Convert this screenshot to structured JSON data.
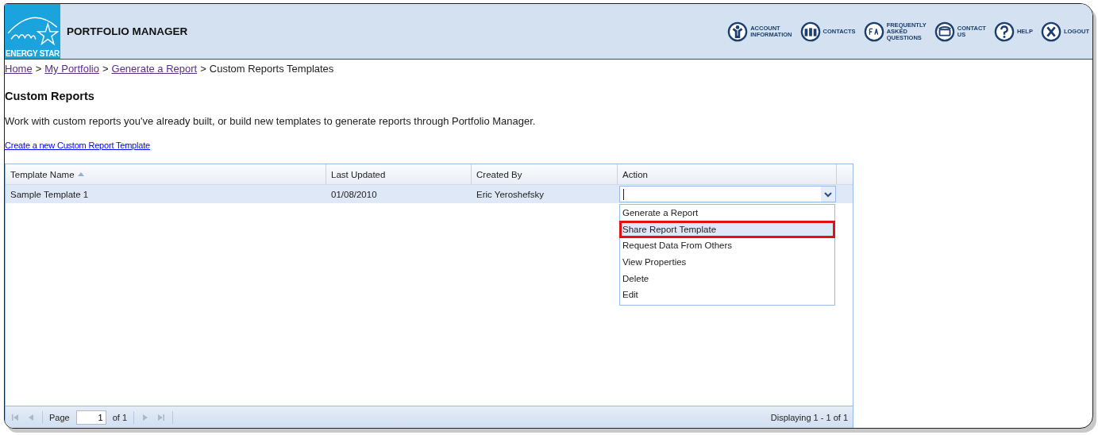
{
  "header": {
    "logo_text": "ENERGY STAR",
    "title": "PORTFOLIO MANAGER",
    "nav": [
      {
        "kind": "account",
        "lines": [
          "ACCOUNT",
          "INFORMATION"
        ]
      },
      {
        "kind": "contacts",
        "lines": [
          "CONTACTS"
        ]
      },
      {
        "kind": "faq",
        "lines": [
          "FREQUENTLY",
          "ASKED",
          "QUESTIONS"
        ]
      },
      {
        "kind": "phone",
        "lines": [
          "CONTACT",
          "US"
        ]
      },
      {
        "kind": "help",
        "lines": [
          "HELP"
        ]
      },
      {
        "kind": "logout",
        "lines": [
          "LOGOUT"
        ]
      }
    ]
  },
  "breadcrumb": {
    "separator": ">",
    "links": [
      "Home",
      "My Portfolio",
      "Generate a Report"
    ],
    "current": "Custom Reports Templates"
  },
  "heading": "Custom Reports",
  "intro": "Work with custom reports you've already built, or build new templates to generate reports through Portfolio Manager.",
  "create_link": "Create a new Custom Report Template",
  "table": {
    "columns": [
      {
        "label": "Template Name",
        "sorted": true
      },
      {
        "label": "Last Updated",
        "sorted": false
      },
      {
        "label": "Created By",
        "sorted": false
      },
      {
        "label": "Action",
        "sorted": false
      }
    ],
    "rows": [
      {
        "selected": true,
        "cells": [
          "Sample Template 1",
          "01/08/2010",
          "Eric Yeroshefsky"
        ]
      }
    ],
    "action_menu": {
      "open": true,
      "items": [
        {
          "label": "Generate a Report",
          "selected": false
        },
        {
          "label": "Share Report Template",
          "selected": true
        },
        {
          "label": "Request Data From Others",
          "selected": false
        },
        {
          "label": "View Properties",
          "selected": false
        },
        {
          "label": "Delete",
          "selected": false
        },
        {
          "label": "Edit",
          "selected": false
        }
      ]
    },
    "pager": {
      "first_disabled": true,
      "prev_disabled": true,
      "next_disabled": true,
      "last_disabled": true,
      "page_label": "Page",
      "page": "1",
      "of": "of 1",
      "display": "Displaying 1 - 1 of 1"
    }
  }
}
